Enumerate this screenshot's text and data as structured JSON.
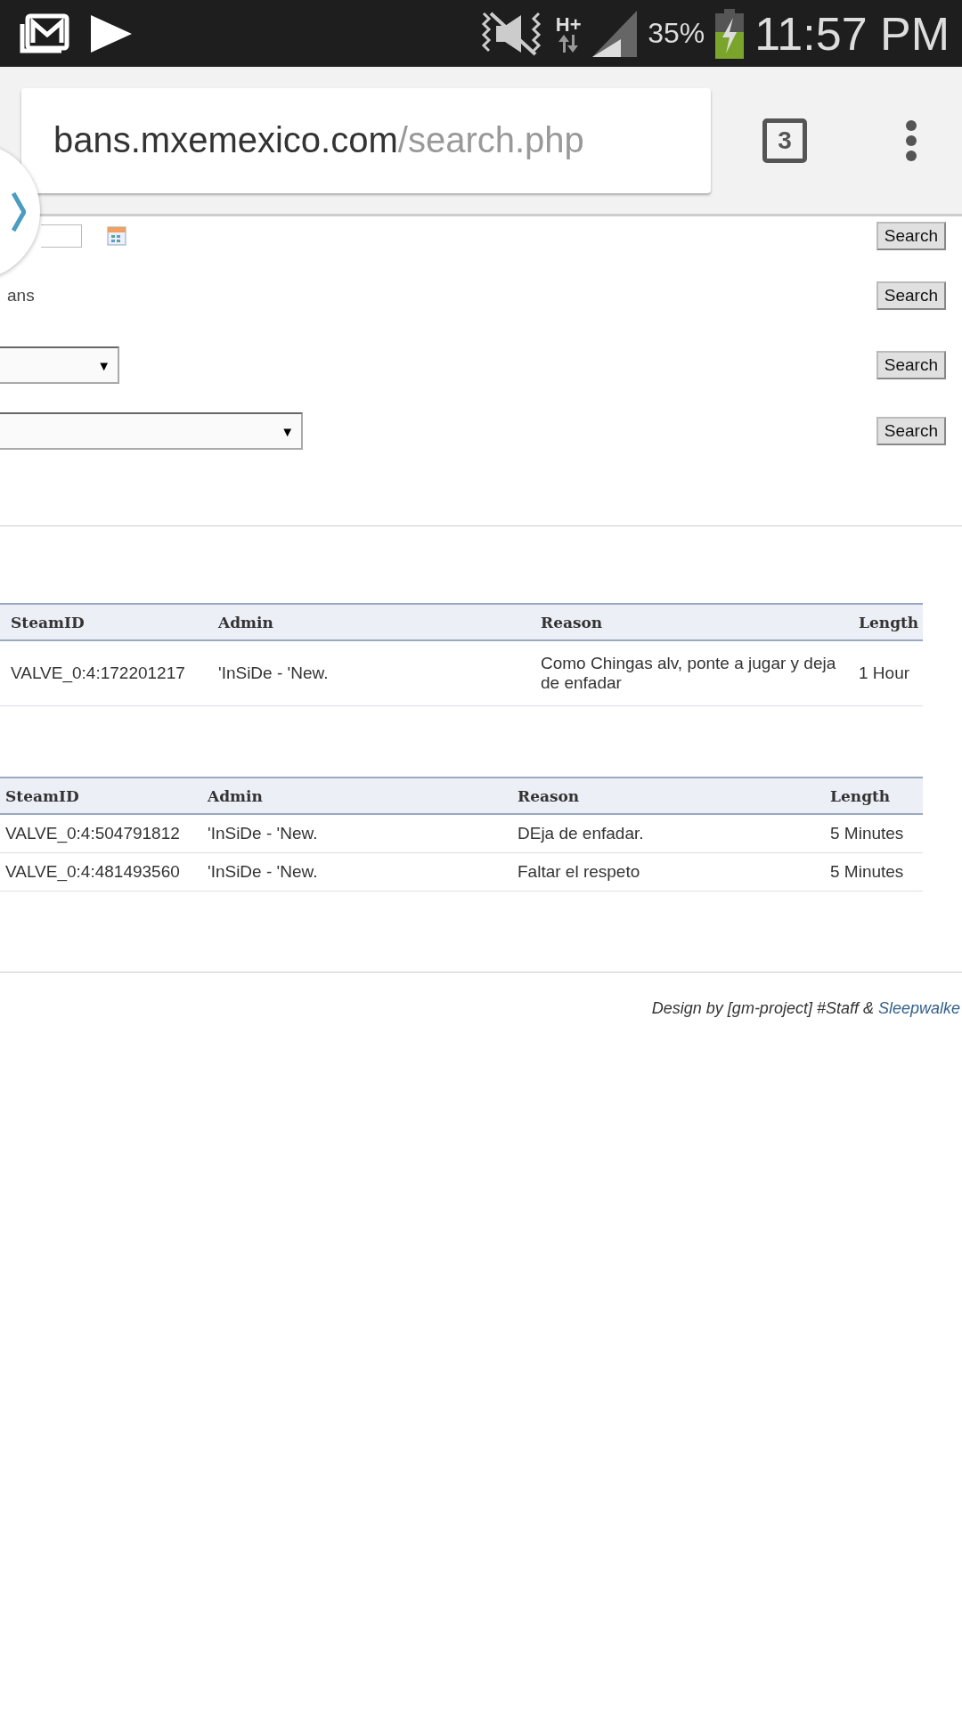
{
  "status_bar": {
    "network": "H+",
    "battery": "35%",
    "time": "11:57 PM"
  },
  "browser": {
    "url_host": "bans.mxemexico.com",
    "url_path": "/search.php",
    "tab_count": "3"
  },
  "search_rows": [
    {
      "kind": "date",
      "button": "Search"
    },
    {
      "kind": "label",
      "label": "ans",
      "button": "Search"
    },
    {
      "kind": "select",
      "wide": false,
      "arrow": "▼",
      "button": "Search"
    },
    {
      "kind": "select",
      "wide": true,
      "arrow": "▼",
      "button": "Search"
    }
  ],
  "tables": [
    {
      "columns": [
        "SteamID",
        "Admin",
        "Reason",
        "Length"
      ],
      "rows": [
        [
          "VALVE_0:4:172201217",
          "'InSiDe - 'New.",
          "Como Chingas alv, ponte a jugar y deja de enfadar",
          "1 Hour"
        ]
      ]
    },
    {
      "columns": [
        "SteamID",
        "Admin",
        "Reason",
        "Length"
      ],
      "rows": [
        [
          "VALVE_0:4:504791812",
          "'InSiDe - 'New.",
          "DEja de enfadar.",
          "5 Minutes"
        ],
        [
          "VALVE_0:4:481493560",
          "'InSiDe - 'New.",
          "Faltar el respeto",
          "5 Minutes"
        ]
      ]
    }
  ],
  "footer": {
    "text": "Design by [gm-project] #Staff & ",
    "link": "Sleepwalke"
  }
}
